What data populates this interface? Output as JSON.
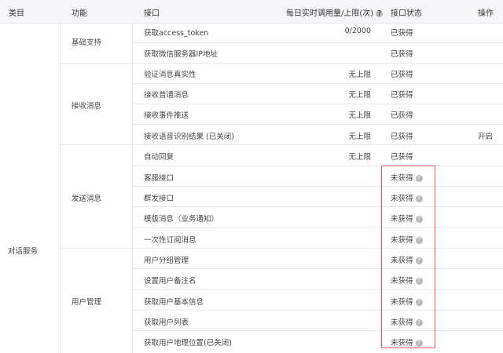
{
  "header": {
    "category": "类目",
    "function": "功能",
    "api": "接口",
    "usage": "每日实时调用量/上限(次)",
    "status": "接口状态",
    "operation": "操作"
  },
  "category": "对话服务",
  "groups": [
    {
      "name": "基础支持"
    },
    {
      "name": "接收消息"
    },
    {
      "name": "发送消息"
    },
    {
      "name": "用户管理"
    }
  ],
  "rows": [
    {
      "api": "获取access_token",
      "usage": "0/2000",
      "status": "已获得",
      "op": ""
    },
    {
      "api": "获取微信服务器IP地址",
      "usage": "",
      "status": "已获得",
      "op": ""
    },
    {
      "api": "验证消息真实性",
      "usage": "无上限",
      "status": "已获得",
      "op": ""
    },
    {
      "api": "接收普通消息",
      "usage": "无上限",
      "status": "已获得",
      "op": ""
    },
    {
      "api": "接收事件推送",
      "usage": "无上限",
      "status": "已获得",
      "op": ""
    },
    {
      "api": "接收语音识别结果 (已关闭)",
      "usage": "无上限",
      "status": "已获得",
      "op": "开启"
    },
    {
      "api": "自动回复",
      "usage": "无上限",
      "status": "已获得",
      "op": ""
    },
    {
      "api": "客服接口",
      "usage": "",
      "status": "未获得",
      "op": ""
    },
    {
      "api": "群发接口",
      "usage": "",
      "status": "未获得",
      "op": ""
    },
    {
      "api": "模版消息（业务通知）",
      "usage": "",
      "status": "未获得",
      "op": ""
    },
    {
      "api": "一次性订阅消息",
      "usage": "",
      "status": "未获得",
      "op": ""
    },
    {
      "api": "用户分组管理",
      "usage": "",
      "status": "未获得",
      "op": ""
    },
    {
      "api": "设置用户备注名",
      "usage": "",
      "status": "未获得",
      "op": ""
    },
    {
      "api": "获取用户基本信息",
      "usage": "",
      "status": "未获得",
      "op": ""
    },
    {
      "api": "获取用户列表",
      "usage": "",
      "status": "未获得",
      "op": ""
    },
    {
      "api": "获取用户地理位置(已关闭)",
      "usage": "",
      "status": "未获得",
      "op": ""
    }
  ],
  "icons": {
    "help": "question-circle-icon"
  },
  "colors": {
    "highlight_border": "#e05a5a",
    "header_bg": "#f4f5f9"
  }
}
